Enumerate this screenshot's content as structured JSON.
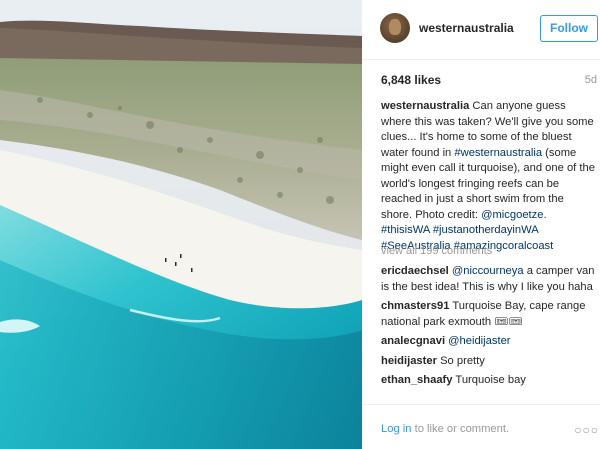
{
  "post": {
    "username": "westernaustralia",
    "follow_label": "Follow",
    "likes": "6,848 likes",
    "time_ago": "5d",
    "caption": {
      "author": "westernaustralia",
      "text": " Can anyone guess where this was taken? We'll give you some clues... It's home to some of the bluest water found in ",
      "tag1": "#westernaustralia",
      "text2": " (some might even call it turquoise), and one of the world's longest fringing reefs can be reached in just a short swim from the shore. Photo credit: ",
      "credit": "@micgoetze",
      "text3": ".",
      "tag2": "#thisisWA",
      "tag3": "#justanotherdayinWA",
      "tag4": "#SeeAustralia",
      "tag5": "#amazingcoralcoast"
    },
    "view_all": "view all 199 comments",
    "comments": [
      {
        "user": "ericdaechsel",
        "mention": "@niccourneya",
        "text": " a camper van is the best idea! This is why I like you haha"
      },
      {
        "user": "chmasters91",
        "mention": "",
        "text": " Turquoise Bay, cape range national park exmouth 🎟🎟"
      },
      {
        "user": "analecgnavi",
        "mention": "@heidijaster",
        "text": ""
      },
      {
        "user": "heidijaster",
        "mention": "",
        "text": " So pretty"
      },
      {
        "user": "ethan_shaafy",
        "mention": "",
        "text": " Turquoise bay"
      }
    ],
    "footer": {
      "login_link": "Log in",
      "login_text": " to like or comment."
    }
  },
  "icons": {
    "avatar": "profile-avatar",
    "more": "ellipsis-icon"
  },
  "colors": {
    "accent": "#3897f0",
    "link": "#003569",
    "text": "#262626",
    "muted": "#999999"
  }
}
